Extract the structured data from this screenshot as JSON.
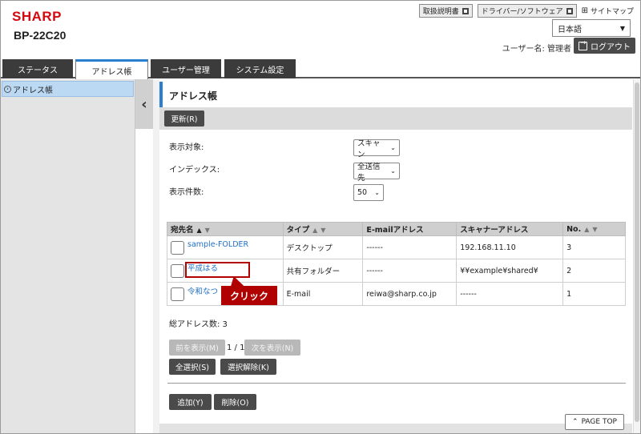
{
  "header": {
    "brand": "SHARP",
    "model": "BP-22C20",
    "links": [
      {
        "label": "取扱説明書"
      },
      {
        "label": "ドライバー/ソフトウェア"
      }
    ],
    "sitemap_label": "サイトマップ",
    "language": "日本語",
    "user_label": "ユーザー名: 管理者",
    "logout_label": "ログアウト"
  },
  "tabs": [
    {
      "label": "ステータス"
    },
    {
      "label": "アドレス帳"
    },
    {
      "label": "ユーザー管理"
    },
    {
      "label": "システム設定"
    }
  ],
  "sidebar": {
    "items": [
      {
        "label": "アドレス帳"
      }
    ],
    "collapse_glyph": "‹"
  },
  "main": {
    "title": "アドレス帳",
    "refresh_label": "更新(R)",
    "filters": [
      {
        "label": "表示対象:",
        "value": "スキャン"
      },
      {
        "label": "インデックス:",
        "value": "全送信先"
      },
      {
        "label": "表示件数:",
        "value": "50"
      }
    ],
    "table": {
      "headers": [
        "宛先名",
        "タイプ",
        "E-mailアドレス",
        "スキャナーアドレス",
        "No."
      ],
      "rows": [
        {
          "name": "sample-FOLDER",
          "type": "デスクトップ",
          "email": "------",
          "scanner": "192.168.11.10",
          "no": "3"
        },
        {
          "name": "平成はる",
          "type": "共有フォルダー",
          "email": "------",
          "scanner": "¥¥example¥shared¥",
          "no": "2"
        },
        {
          "name": "令和なつ",
          "type": "E-mail",
          "email": "reiwa@sharp.co.jp",
          "scanner": "------",
          "no": "1"
        }
      ]
    },
    "callout": "クリック",
    "total_label": "総アドレス数: 3",
    "pager": {
      "prev": "前を表示(M)",
      "status": "1 / 1",
      "next": "次を表示(N)"
    },
    "select_all": "全選択(S)",
    "deselect": "選択解除(K)",
    "add": "追加(Y)",
    "delete": "削除(O)",
    "page_top": "PAGE TOP"
  }
}
